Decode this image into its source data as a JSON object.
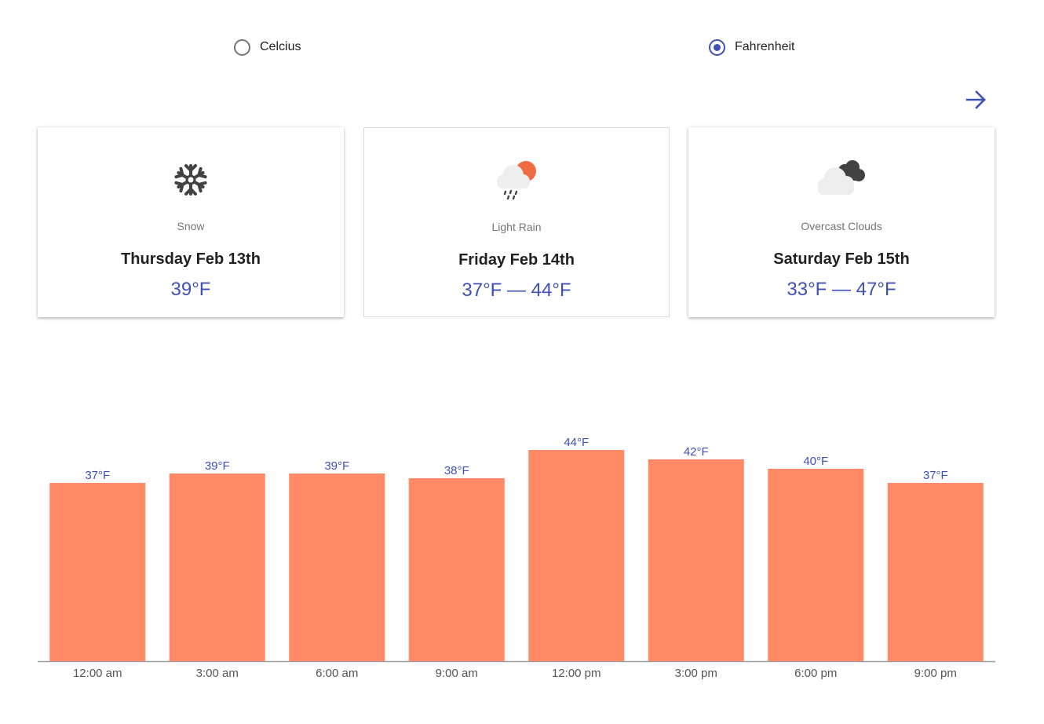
{
  "units": {
    "celsius_label": "Celcius",
    "fahrenheit_label": "Fahrenheit",
    "selected": "fahrenheit"
  },
  "cards": [
    {
      "icon": "snowflake-icon",
      "description": "Snow",
      "day": "Thursday Feb 13th",
      "temp": "39°F"
    },
    {
      "icon": "light-rain-icon",
      "description": "Light Rain",
      "day": "Friday Feb 14th",
      "temp": "37°F — 44°F"
    },
    {
      "icon": "overcast-clouds-icon",
      "description": "Overcast Clouds",
      "day": "Saturday Feb 15th",
      "temp": "33°F — 47°F"
    }
  ],
  "colors": {
    "accent": "#3f51b5",
    "bar": "#ff8a65",
    "axis": "#9e9e9e",
    "tick_text": "#555555"
  },
  "chart_data": {
    "type": "bar",
    "categories": [
      "12:00 am",
      "3:00 am",
      "6:00 am",
      "9:00 am",
      "12:00 pm",
      "3:00 pm",
      "6:00 pm",
      "9:00 pm"
    ],
    "values": [
      37,
      39,
      39,
      38,
      44,
      42,
      40,
      37
    ],
    "data_labels": [
      "37°F",
      "39°F",
      "39°F",
      "38°F",
      "44°F",
      "42°F",
      "40°F",
      "37°F"
    ],
    "title": "",
    "xlabel": "",
    "ylabel": "",
    "grid": false,
    "legend": "none"
  }
}
